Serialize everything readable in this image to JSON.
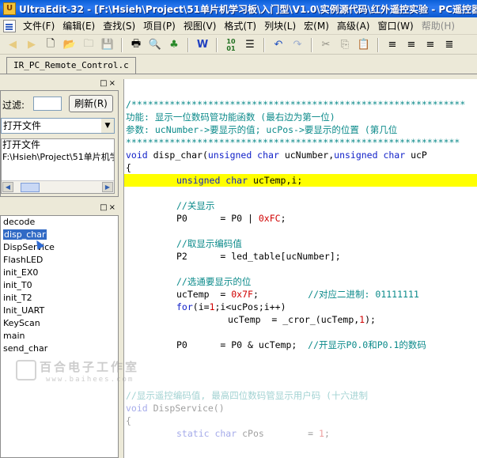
{
  "window": {
    "title": "UltraEdit-32 - [F:\\Hsieh\\Project\\51单片机学习板\\入门型\\V1.0\\实例源代码\\红外遥控实验 - PC遥控器(C语言"
  },
  "menu": {
    "items": [
      "文件(F)",
      "编辑(E)",
      "查找(S)",
      "项目(P)",
      "视图(V)",
      "格式(T)",
      "列块(L)",
      "宏(M)",
      "高级(A)",
      "窗口(W)",
      "帮助(H)"
    ]
  },
  "tabs": [
    {
      "label": "IR_PC_Remote_Control.c"
    }
  ],
  "file_browser": {
    "filter_label": "过滤:",
    "refresh_label": "刷新(R)",
    "selected_option": "打开文件",
    "tree": [
      "打开文件",
      "F:\\Hsieh\\Project\\51单片机学"
    ]
  },
  "function_list": {
    "items": [
      "decode",
      "disp_char",
      "DispService",
      "FlashLED",
      "init_EX0",
      "init_T0",
      "init_T2",
      "Init_UART",
      "KeyScan",
      "main",
      "send_char"
    ],
    "selected": "disp_char"
  },
  "code": {
    "l1": "/*************************************************************",
    "l2": "功能: 显示一位数码管功能函数 (最右边为第一位)",
    "l3": "参数: ucNumber->要显示的值; ucPos->要显示的位置 (第几位",
    "l4": "*************************************************************",
    "l5a": "void",
    "l5b": " disp_char(",
    "l5c": "unsigned char",
    "l5d": " ucNumber,",
    "l5e": "unsigned char",
    "l5f": " ucP",
    "l6": "{",
    "l7a": "unsigned char",
    "l7b": " ucTemp,i;",
    "l8": "//关显示",
    "l9a": "P0      = P0 | ",
    "l9b": "0xFC",
    "l9c": ";",
    "l10": "//取显示编码值",
    "l11": "P2      = led_table[ucNumber];",
    "l12": "//选通要显示的位",
    "l13a": "ucTemp  = ",
    "l13b": "0x7F",
    "l13c": ";         ",
    "l13d": "//对应二进制: 01111111",
    "l14a": "for",
    "l14b": "(i=",
    "l14c": "1",
    "l14d": ";i<ucPos;i++)",
    "l15a": "ucTemp  = _cror_(ucTemp,",
    "l15b": "1",
    "l15c": ");",
    "l16a": "P0      = P0 & ucTemp;  ",
    "l16b": "//开显示P0.0和P0.1的数码",
    "l17": "//显示遥控编码值, 最高四位数码管显示用户码 (十六进制",
    "l18a": "void",
    "l18b": " DispService()",
    "l19": "{",
    "l20a": "static char",
    "l20b": " cPos        = ",
    "l20c": "1",
    "l20d": ";"
  },
  "watermark": {
    "main": "百合电子工作室",
    "url": "www.baihees.com"
  }
}
